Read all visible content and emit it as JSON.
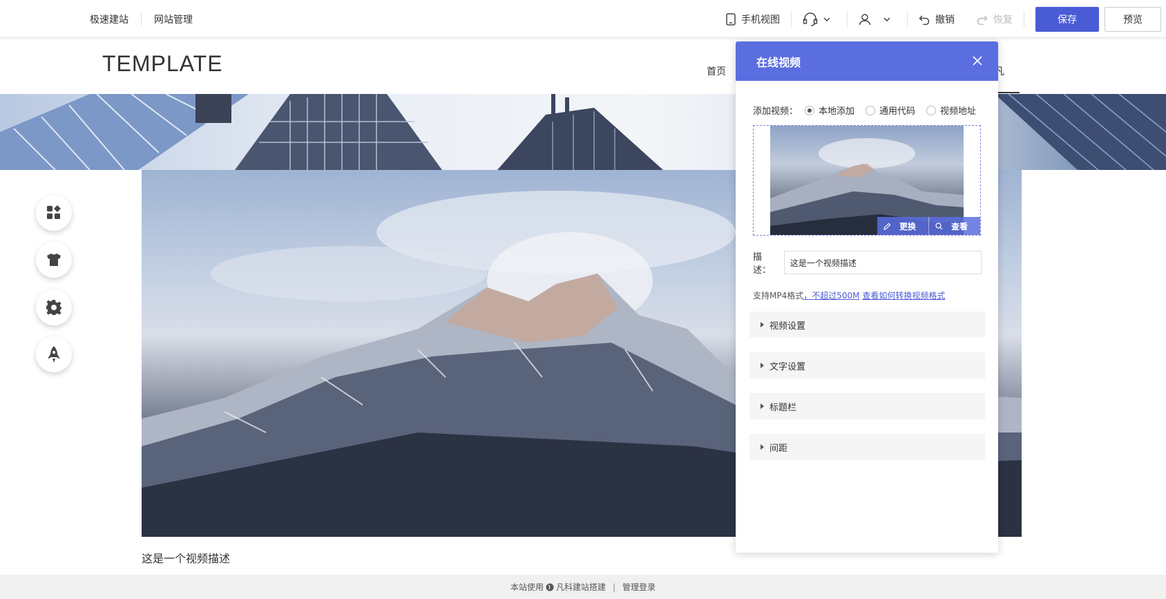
{
  "topbar": {
    "left_nav": [
      "极速建站",
      "网站管理"
    ],
    "mobile_view": "手机视图",
    "undo": "撤销",
    "redo": "恢复",
    "save": "保存",
    "preview": "预览"
  },
  "site": {
    "logo": "TEMPLATE",
    "nav_home": "首页",
    "nav_partial": "凡",
    "video_caption": "这是一个视频描述"
  },
  "footer": {
    "prefix": "本站使用",
    "brand": "凡科建站搭建",
    "separator": "|",
    "admin_login": "管理登录"
  },
  "panel": {
    "title": "在线视频",
    "add_label": "添加视频：",
    "options": [
      "本地添加",
      "通用代码",
      "视频地址"
    ],
    "selected_option": "本地添加",
    "replace": "更换",
    "view": "查看",
    "desc_label": "描述：",
    "desc_value": "这是一个视频描述",
    "hint_text": "支持MP4格式",
    "hint_limit": "，不超过500M",
    "hint_link": "查看如何转换视频格式",
    "sections": [
      "视频设置",
      "文字设置",
      "标题栏",
      "间距"
    ]
  },
  "colors": {
    "primary": "#4a5bd6",
    "panel_header": "#5b6ee0"
  }
}
